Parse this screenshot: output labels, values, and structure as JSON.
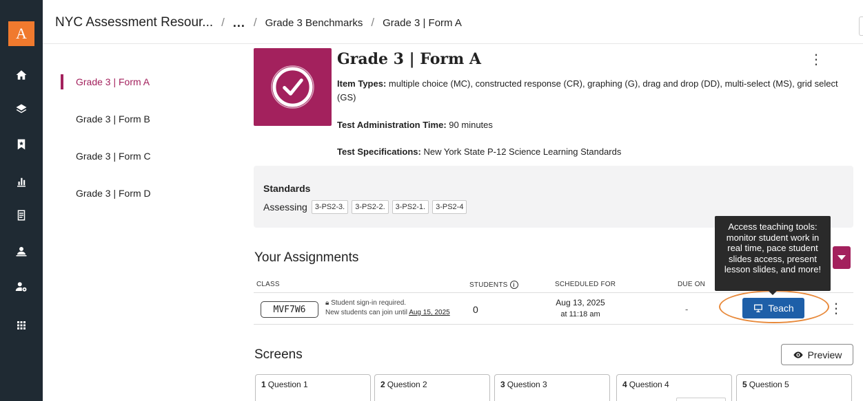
{
  "rail": {
    "logo_letter": "A",
    "icons": [
      "home-icon",
      "layers-icon",
      "bookmark-icon",
      "bar-chart-icon",
      "document-icon",
      "teacher-icon",
      "users-gear-icon",
      "grid-icon"
    ]
  },
  "breadcrumb": {
    "root": "NYC Assessment Resour...",
    "more": "...",
    "items": [
      "Grade 3 Benchmarks",
      "Grade 3 | Form A"
    ]
  },
  "sidenav": {
    "items": [
      {
        "label": "Grade 3 | Form A",
        "active": true
      },
      {
        "label": "Grade 3 | Form B",
        "active": false
      },
      {
        "label": "Grade 3 | Form C",
        "active": false
      },
      {
        "label": "Grade 3 | Form D",
        "active": false
      }
    ]
  },
  "header": {
    "title": "Grade 3 | Form A",
    "item_types_label": "Item Types:",
    "item_types_value": "multiple choice (MC), constructed response (CR), graphing (G), drag and drop (DD), multi-select (MS), grid select (GS)",
    "admin_time_label": "Test Administration Time:",
    "admin_time_value": "90 minutes",
    "specs_label": "Test Specifications:",
    "specs_value": "New York State P-12 Science Learning Standards",
    "thumb_color": "#a3215d"
  },
  "standards": {
    "title": "Standards",
    "assessing_label": "Assessing",
    "chips": [
      "3-PS2-3.",
      "3-PS2-2.",
      "3-PS2-1.",
      "3-PS2-4"
    ]
  },
  "assignments": {
    "title": "Your Assignments",
    "columns": {
      "class": "CLASS",
      "students": "STUDENTS",
      "scheduled": "SCHEDULED FOR",
      "due": "DUE ON"
    },
    "row": {
      "class_code": "MVF7W6",
      "signin_required": "Student sign-in required.",
      "join_until_prefix": "New students can join until",
      "join_until_date": "Aug 15, 2025",
      "students": "0",
      "scheduled_date": "Aug 13, 2025",
      "scheduled_time": "at 11:18 am",
      "due": "-",
      "teach_label": "Teach"
    },
    "tooltip": "Access teaching tools: monitor student work in real time, pace student slides access, present lesson slides, and more!"
  },
  "screens": {
    "title": "Screens",
    "preview_label": "Preview",
    "cards": [
      {
        "num": "1",
        "label": "Question 1"
      },
      {
        "num": "2",
        "label": "Question 2"
      },
      {
        "num": "3",
        "label": "Question 3"
      },
      {
        "num": "4",
        "label": "Question 4"
      },
      {
        "num": "5",
        "label": "Question 5"
      }
    ]
  },
  "colors": {
    "accent": "#a3215d",
    "rail_bg": "#1f2a33",
    "logo_bg": "#f07a2e",
    "teach_bg": "#1e5fa8",
    "highlight_oval": "#e8893a"
  }
}
